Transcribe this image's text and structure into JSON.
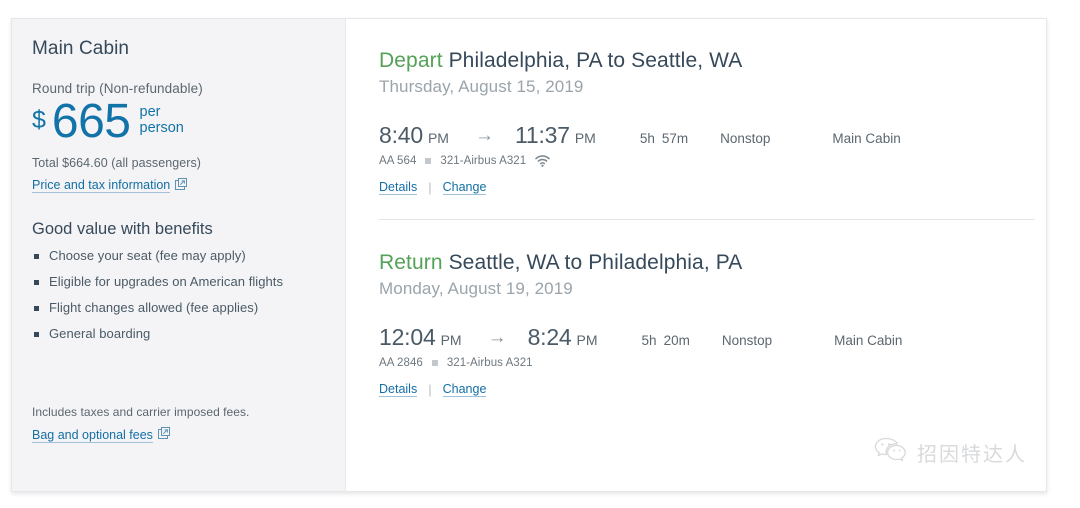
{
  "fare": {
    "title": "Main Cabin",
    "subtitle": "Round trip (Non-refundable)",
    "currency_symbol": "$",
    "price": "665",
    "unit_line1": "per",
    "unit_line2": "person",
    "total": "Total $664.60 (all passengers)",
    "price_tax_link": "Price and tax information",
    "benefits_title": "Good value with benefits",
    "benefits": [
      "Choose your seat (fee may apply)",
      "Eligible for upgrades on American flights",
      "Flight changes allowed (fee applies)",
      "General boarding"
    ],
    "footer_note": "Includes taxes and carrier imposed fees.",
    "bag_fees_link": "Bag and optional fees",
    "accent_color": "#1273a8",
    "panel_bg": "#f4f4f6"
  },
  "itinerary": {
    "legs": [
      {
        "kind": "Depart",
        "route": "Philadelphia, PA to Seattle, WA",
        "date": "Thursday, August 15, 2019",
        "depart_time": "8:40",
        "depart_meridiem": "PM",
        "arrow": "→",
        "arrive_time": "11:37",
        "arrive_meridiem": "PM",
        "duration_hours": "5h",
        "duration_minutes": "57m",
        "stops": "Nonstop",
        "cabin": "Main Cabin",
        "flight_number": "AA 564",
        "aircraft": "321-Airbus A321",
        "has_wifi": true,
        "details_label": "Details",
        "separator": "|",
        "change_label": "Change"
      },
      {
        "kind": "Return",
        "route": "Seattle, WA to Philadelphia, PA",
        "date": "Monday, August 19, 2019",
        "depart_time": "12:04",
        "depart_meridiem": "PM",
        "arrow": "→",
        "arrive_time": "8:24",
        "arrive_meridiem": "PM",
        "duration_hours": "5h",
        "duration_minutes": "20m",
        "stops": "Nonstop",
        "cabin": "Main Cabin",
        "flight_number": "AA 2846",
        "aircraft": "321-Airbus A321",
        "has_wifi": false,
        "details_label": "Details",
        "separator": "|",
        "change_label": "Change"
      }
    ],
    "heading_accent_color": "#54a157"
  },
  "watermark": {
    "text": "招因特达人",
    "icon": "wechat-icon"
  }
}
